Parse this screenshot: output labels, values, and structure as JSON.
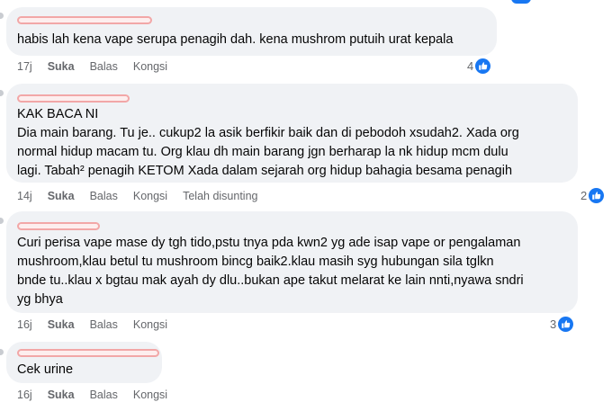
{
  "comments": [
    {
      "text": "habis lah kena vape serupa penagih dah. kena mushrom putuih urat kepala",
      "time": "17j",
      "like_label": "Suka",
      "reply_label": "Balas",
      "share_label": "Kongsi",
      "edited_label": "",
      "reaction_count": "4"
    },
    {
      "text": "KAK BACA NI\nDia main barang. Tu je.. cukup2 la asik berfikir baik dan di pebodoh xsudah2. Xada org\nnormal hidup macam tu. Org klau dh main barang jgn berharap la nk hidup mcm dulu\nlagi. Tabah² penagih KETOM Xada dalam sejarah org hidup bahagia besama penagih",
      "time": "14j",
      "like_label": "Suka",
      "reply_label": "Balas",
      "share_label": "Kongsi",
      "edited_label": "Telah disunting",
      "reaction_count": "2"
    },
    {
      "text": "Curi perisa vape mase dy tgh tido,pstu tnya pda kwn2 yg ade isap vape or pengalaman\nmushroom,klau betul tu mushroom bincg baik2.klau masih syg hubungan sila tglkn\nbnde tu..klau x bgtau mak ayah dy dlu..bukan ape takut melarat ke lain nnti,nyawa sndri\nyg bhya",
      "time": "16j",
      "like_label": "Suka",
      "reply_label": "Balas",
      "share_label": "Kongsi",
      "edited_label": "",
      "reaction_count": "3"
    },
    {
      "text": "Cek urine",
      "time": "16j",
      "like_label": "Suka",
      "reply_label": "Balas",
      "share_label": "Kongsi",
      "edited_label": "",
      "reaction_count": ""
    }
  ],
  "colors": {
    "bubble": "#f0f2f5",
    "like_blue": "#1877f2",
    "meta_gray": "#65676b",
    "redaction": "#f2a7a7"
  },
  "icons": {
    "reaction": "thumbs-up-icon"
  }
}
